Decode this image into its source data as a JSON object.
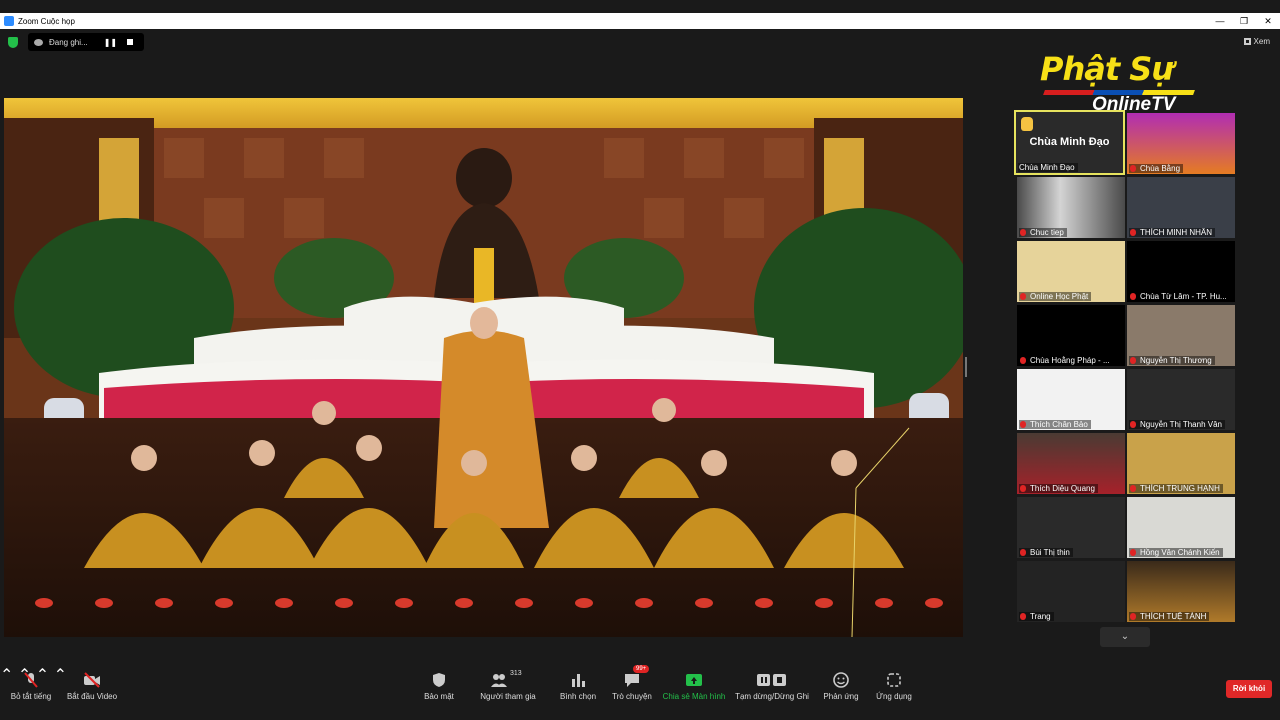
{
  "window": {
    "title": "Zoom Cuộc họp"
  },
  "top_bar": {
    "recording_label": "Đang ghi...",
    "view_label": "Xem"
  },
  "logo": {
    "line1": "Phật Sự",
    "line2": "OnlineTV"
  },
  "gallery": {
    "active_tile": {
      "big_name": "Chùa Minh Đạo",
      "label": "Chùa Minh Đạo"
    },
    "tiles": [
      {
        "label": "Chùa Bằng"
      },
      {
        "label": "Chuc tiep"
      },
      {
        "label": "THÍCH MINH NHÂN"
      },
      {
        "label": "Online Học Phật"
      },
      {
        "label": "Chùa Từ Lâm - TP. Hu..."
      },
      {
        "label": "Chùa Hoằng Pháp - ..."
      },
      {
        "label": "Nguyễn Thị Thương"
      },
      {
        "label": "Thích Chân Bảo"
      },
      {
        "label": "Nguyễn Thị Thanh Vân"
      },
      {
        "label": "Thích Diệu Quang"
      },
      {
        "label": "THÍCH TRUNG HẠNH"
      },
      {
        "label": "Bùi Thị thin"
      },
      {
        "label": "Hồng Vân Chánh Kiến"
      },
      {
        "label": "Trang"
      },
      {
        "label": "THÍCH TUỆ TÁNH"
      }
    ]
  },
  "toolbar": {
    "mute": "Bỏ tắt tiếng",
    "video": "Bắt đầu Video",
    "security": "Bảo mật",
    "participants": "Người tham gia",
    "participants_count": "313",
    "polls": "Bình chọn",
    "chat": "Trò chuyện",
    "chat_badge": "99+",
    "share": "Chia sẻ Màn hình",
    "pause_record": "Tạm dừng/Dừng Ghi",
    "reactions": "Phản ứng",
    "apps": "Ứng dụng",
    "leave": "Rời khỏi"
  },
  "colors": {
    "accent_green": "#23c04a",
    "leave_red": "#e02828",
    "active_border": "#e6e35e",
    "logo_yellow": "#f7e017"
  }
}
